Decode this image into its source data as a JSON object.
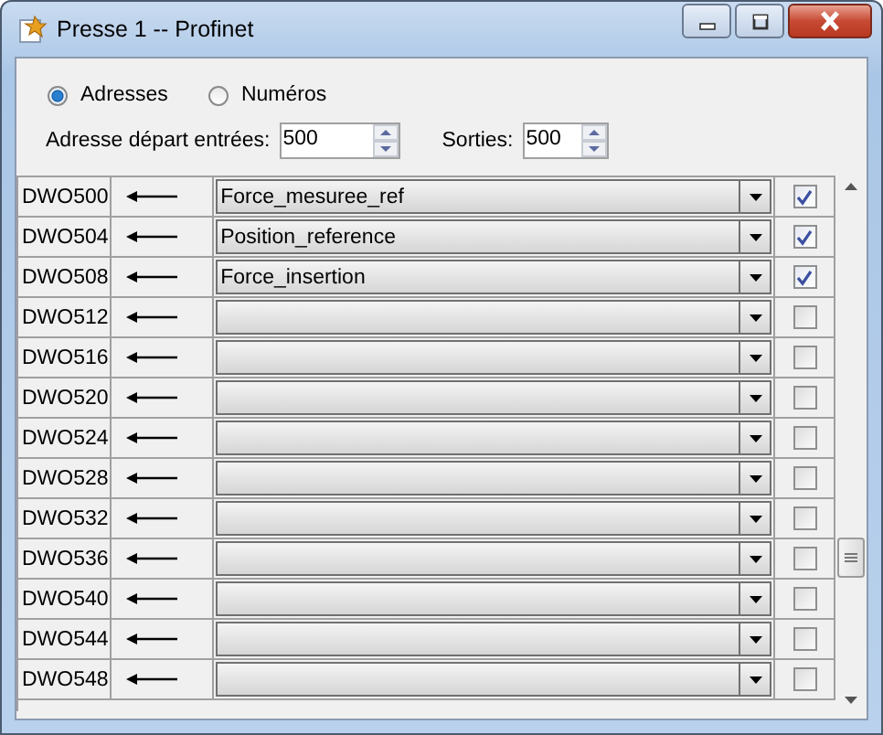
{
  "window": {
    "title": "Presse 1 -- Profinet"
  },
  "mode": [
    {
      "label": "Adresses",
      "selected": true
    },
    {
      "label": "Numéros",
      "selected": false
    }
  ],
  "start_inputs": {
    "label": "Adresse départ entrées:",
    "value": "500"
  },
  "outputs": {
    "label": "Sorties:",
    "value": "500"
  },
  "rows": [
    {
      "address": "DWO500",
      "variable": "Force_mesuree_ref",
      "checked": true
    },
    {
      "address": "DWO504",
      "variable": "Position_reference",
      "checked": true
    },
    {
      "address": "DWO508",
      "variable": "Force_insertion",
      "checked": true
    },
    {
      "address": "DWO512",
      "variable": "",
      "checked": false
    },
    {
      "address": "DWO516",
      "variable": "",
      "checked": false
    },
    {
      "address": "DWO520",
      "variable": "",
      "checked": false
    },
    {
      "address": "DWO524",
      "variable": "",
      "checked": false
    },
    {
      "address": "DWO528",
      "variable": "",
      "checked": false
    },
    {
      "address": "DWO532",
      "variable": "",
      "checked": false
    },
    {
      "address": "DWO536",
      "variable": "",
      "checked": false
    },
    {
      "address": "DWO540",
      "variable": "",
      "checked": false
    },
    {
      "address": "DWO544",
      "variable": "",
      "checked": false
    },
    {
      "address": "DWO548",
      "variable": "",
      "checked": false
    }
  ]
}
